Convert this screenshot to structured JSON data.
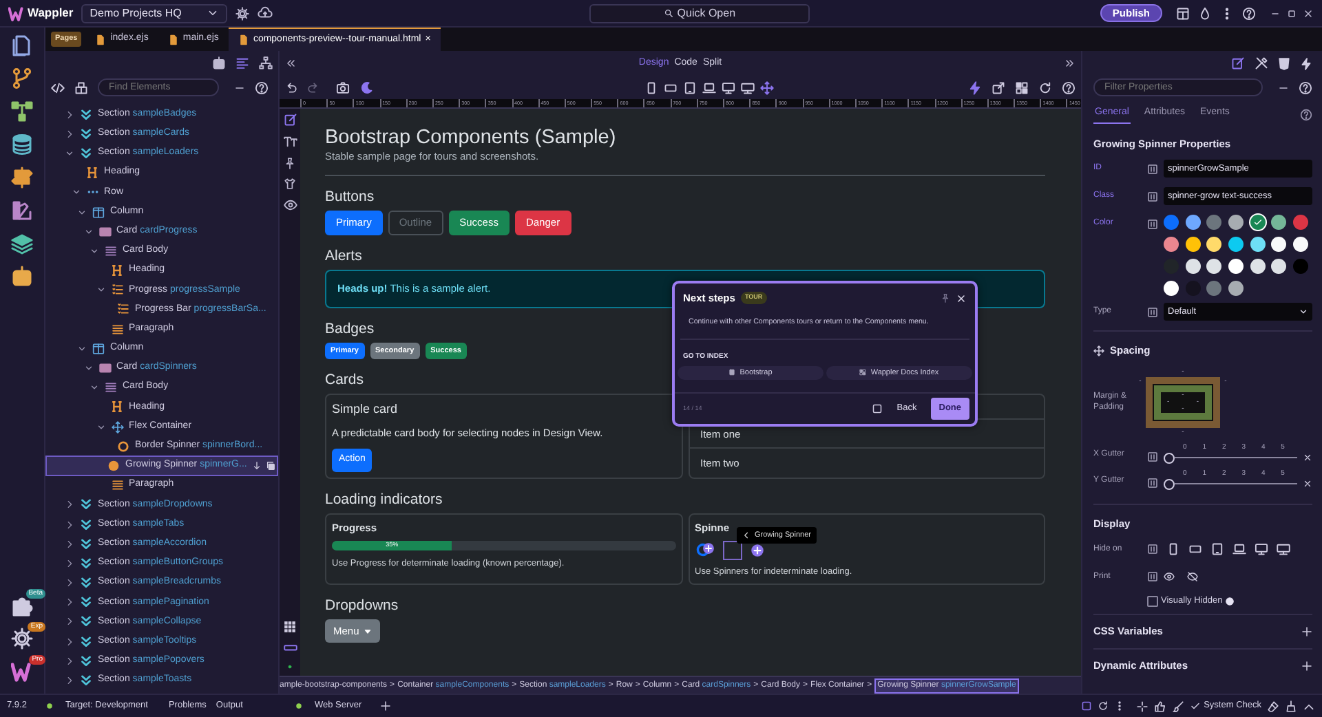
{
  "app": {
    "name": "Wappler",
    "project": "Demo Projects HQ",
    "quick_open": "Quick Open",
    "publish": "Publish"
  },
  "rail": {
    "badges": [
      "Beta",
      "Exp",
      "Pro"
    ]
  },
  "tabs": {
    "group": "Pages",
    "items": [
      {
        "label": "index.ejs",
        "selected": false
      },
      {
        "label": "main.ejs",
        "selected": false
      },
      {
        "label": "components-preview--tour-manual.html",
        "selected": true,
        "close": "×"
      }
    ]
  },
  "structure": {
    "search": {
      "placeholder": "Find Elements"
    },
    "tree": [
      {
        "label": "Section",
        "id": "sampleBadges",
        "kind": "section",
        "expanded": false,
        "selected": false
      },
      {
        "label": "Section",
        "id": "sampleCards",
        "kind": "section",
        "expanded": false,
        "selected": false
      },
      {
        "label": "Section",
        "id": "sampleLoaders",
        "kind": "section",
        "expanded": true,
        "selected": false,
        "children": [
          {
            "label": "Heading",
            "kind": "heading",
            "selected": false
          },
          {
            "label": "Row",
            "kind": "row",
            "expanded": true,
            "selected": false,
            "children": [
              {
                "label": "Column",
                "kind": "column",
                "expanded": true,
                "selected": false,
                "children": [
                  {
                    "label": "Card",
                    "id": "cardProgress",
                    "kind": "card",
                    "expanded": true,
                    "selected": false,
                    "children": [
                      {
                        "label": "Card Body",
                        "kind": "card-body",
                        "expanded": true,
                        "selected": false,
                        "children": [
                          {
                            "label": "Heading",
                            "kind": "heading",
                            "selected": false
                          },
                          {
                            "label": "Progress",
                            "id": "progressSample",
                            "kind": "progress",
                            "expanded": true,
                            "selected": false,
                            "children": [
                              {
                                "label": "Progress Bar",
                                "id": "progressBarSa...",
                                "kind": "progress",
                                "selected": false
                              }
                            ]
                          },
                          {
                            "label": "Paragraph",
                            "kind": "paragraph",
                            "selected": false
                          }
                        ]
                      }
                    ]
                  }
                ]
              },
              {
                "label": "Column",
                "kind": "column",
                "expanded": true,
                "selected": false,
                "children": [
                  {
                    "label": "Card",
                    "id": "cardSpinners",
                    "kind": "card",
                    "expanded": true,
                    "selected": false,
                    "children": [
                      {
                        "label": "Card Body",
                        "kind": "card-body",
                        "expanded": true,
                        "selected": false,
                        "children": [
                          {
                            "label": "Heading",
                            "kind": "heading",
                            "selected": false
                          },
                          {
                            "label": "Flex Container",
                            "kind": "flex",
                            "expanded": true,
                            "selected": false,
                            "children": [
                              {
                                "label": "Border Spinner",
                                "id": "spinnerBord...",
                                "kind": "border-spinner",
                                "selected": false
                              },
                              {
                                "label": "Growing Spinner",
                                "id": "spinnerG...",
                                "kind": "grow-spinner",
                                "selected": true
                              }
                            ]
                          },
                          {
                            "label": "Paragraph",
                            "kind": "paragraph",
                            "selected": false
                          }
                        ]
                      }
                    ]
                  }
                ]
              }
            ]
          }
        ]
      },
      {
        "label": "Section",
        "id": "sampleDropdowns",
        "kind": "section",
        "expanded": false,
        "selected": false
      },
      {
        "label": "Section",
        "id": "sampleTabs",
        "kind": "section",
        "expanded": false,
        "selected": false
      },
      {
        "label": "Section",
        "id": "sampleAccordion",
        "kind": "section",
        "expanded": false,
        "selected": false
      },
      {
        "label": "Section",
        "id": "sampleButtonGroups",
        "kind": "section",
        "expanded": false,
        "selected": false
      },
      {
        "label": "Section",
        "id": "sampleBreadcrumbs",
        "kind": "section",
        "expanded": false,
        "selected": false
      },
      {
        "label": "Section",
        "id": "samplePagination",
        "kind": "section",
        "expanded": false,
        "selected": false
      },
      {
        "label": "Section",
        "id": "sampleCollapse",
        "kind": "section",
        "expanded": false,
        "selected": false
      },
      {
        "label": "Section",
        "id": "sampleTooltips",
        "kind": "section",
        "expanded": false,
        "selected": false
      },
      {
        "label": "Section",
        "id": "samplePopovers",
        "kind": "section",
        "expanded": false,
        "selected": false
      },
      {
        "label": "Section",
        "id": "sampleToasts",
        "kind": "section",
        "expanded": false,
        "selected": false
      }
    ]
  },
  "view_modes": [
    {
      "label": "Design",
      "selected": true
    },
    {
      "label": "Code",
      "selected": false
    },
    {
      "label": "Split",
      "selected": false
    }
  ],
  "ruler": {
    "labels": [
      "0",
      "50",
      "100",
      "150",
      "200",
      "250",
      "300",
      "350",
      "400",
      "450",
      "500",
      "550",
      "600",
      "650",
      "700",
      "750",
      "800",
      "850",
      "900",
      "950",
      "1000",
      "1050",
      "1100",
      "1150",
      "1200",
      "1250",
      "1300",
      "1350",
      "1400",
      "1450"
    ]
  },
  "canvas": {
    "title": "Bootstrap Components (Sample)",
    "subtitle": "Stable sample page for tours and screenshots.",
    "buttons_heading": "Buttons",
    "buttons": [
      {
        "label": "Primary"
      },
      {
        "label": "Outline"
      },
      {
        "label": "Success"
      },
      {
        "label": "Danger"
      }
    ],
    "alerts_heading": "Alerts",
    "alert": "**Heads up!** This is a sample alert.",
    "badges_heading": "Badges",
    "badges": [
      {
        "label": "Primary"
      },
      {
        "label": "Secondary"
      },
      {
        "label": "Success"
      }
    ],
    "cards_heading": "Cards",
    "card": {
      "title": "Simple card",
      "text": "A predictable card body for selecting nodes in Design View.",
      "button": "Action"
    },
    "list_items": [
      "Item one",
      "Item two"
    ],
    "loading_heading": "Loading indicators",
    "progress_card": {
      "title": "Progress",
      "level": 0.35,
      "reading": "35%",
      "text": "Use Progress for determinate loading (known percentage)."
    },
    "spinner_card": {
      "title": "Spinne",
      "text": "Use Spinners for indeterminate loading."
    },
    "dropdowns_heading": "Dropdowns",
    "dropdown": "Menu"
  },
  "tour": {
    "title": "Next steps",
    "badge": "TOUR",
    "text": "Continue with other Components tours or return to the Components menu.",
    "index_heading": "GO TO INDEX",
    "links": [
      "Bootstrap",
      "Wappler Docs Index"
    ],
    "step": "14 / 14",
    "back": "Back",
    "done": "Done"
  },
  "tooltip": {
    "label": "Growing Spinner"
  },
  "breadcrumb": [
    {
      "type": "ample-bootstrap-components",
      "selected": false
    },
    {
      "sep": ">",
      "type": "Container",
      "id": "sampleComponents",
      "selected": false
    },
    {
      "sep": ">",
      "type": "Section",
      "id": "sampleLoaders",
      "selected": false
    },
    {
      "sep": ">",
      "type": "Row",
      "selected": false
    },
    {
      "sep": ">",
      "type": "Column",
      "selected": false
    },
    {
      "sep": ">",
      "type": "Card",
      "id": "cardSpinners",
      "selected": false
    },
    {
      "sep": ">",
      "type": "Card Body",
      "selected": false
    },
    {
      "sep": ">",
      "type": "Flex Container",
      "selected": false
    },
    {
      "sep": ">",
      "type": "Growing Spinner",
      "id": "spinnerGrowSample",
      "selected": true
    }
  ],
  "properties": {
    "search": {
      "placeholder": "Filter Properties"
    },
    "tabs": [
      {
        "label": "General",
        "selected": true
      },
      {
        "label": "Attributes",
        "selected": false
      },
      {
        "label": "Events",
        "selected": false
      }
    ],
    "title": "Growing Spinner Properties",
    "fields": [
      {
        "label": "ID",
        "set": true,
        "kind": "text",
        "value": "spinnerGrowSample"
      },
      {
        "label": "Class",
        "set": true,
        "kind": "text",
        "value": "spinner-grow text-success"
      },
      {
        "label": "Color",
        "set": true,
        "kind": "colors",
        "swatches": [
          {
            "color": "#0d6efd",
            "selected": false
          },
          {
            "color": "#6ea8fe",
            "selected": false
          },
          {
            "color": "#6c757d",
            "selected": false
          },
          {
            "color": "#a7acb1",
            "selected": false
          },
          {
            "color": "#198754",
            "selected": true
          },
          {
            "color": "#75b798",
            "selected": false
          },
          {
            "color": "#dc3545",
            "selected": false
          },
          {
            "color": "#ea868f",
            "selected": false
          },
          {
            "color": "#ffc107",
            "selected": false
          },
          {
            "color": "#ffda6a",
            "selected": false
          },
          {
            "color": "#0dcaf0",
            "selected": false
          },
          {
            "color": "#6edff6",
            "selected": false
          },
          {
            "color": "#f8f9fa",
            "selected": false
          },
          {
            "color": "#f8f9fa",
            "selected": false
          },
          {
            "color": "#212529",
            "selected": false
          },
          {
            "color": "#dee2e6",
            "selected": false
          },
          {
            "color": "#dee2e6",
            "selected": false
          },
          {
            "color": "#ffffff",
            "selected": false
          },
          {
            "color": "#dee2e6",
            "selected": false
          },
          {
            "color": "#dee2e6",
            "selected": false
          },
          {
            "color": "#000000",
            "selected": false
          },
          {
            "color": "#ffffff",
            "selected": false
          },
          {
            "color": "#15121f",
            "selected": false
          },
          {
            "color": "#6c757d",
            "selected": false
          },
          {
            "color": "#a7acb1",
            "selected": false
          }
        ]
      },
      {
        "label": "Type",
        "set": false,
        "kind": "select",
        "value": "Default"
      }
    ],
    "spacing": {
      "title": "Spacing",
      "box_label": "Margin & Padding",
      "margin": [
        "-",
        "-",
        "-",
        "-"
      ],
      "padding": [
        "-",
        "-",
        "-",
        "-"
      ],
      "gutters": [
        {
          "label": "X Gutter",
          "ticks": [
            "0",
            "1",
            "2",
            "3",
            "4",
            "5"
          ],
          "level": 0
        },
        {
          "label": "Y Gutter",
          "ticks": [
            "0",
            "1",
            "2",
            "3",
            "4",
            "5"
          ],
          "level": 0
        }
      ]
    },
    "display": {
      "title": "Display",
      "hide_on": "Hide on",
      "print": "Print",
      "visually_hidden": {
        "label": "Visually Hidden",
        "checked": false
      }
    },
    "sections": [
      "CSS Variables",
      "Dynamic Attributes"
    ]
  },
  "status_bar": {
    "version": "7.9.2",
    "target": "Target: Development",
    "tabs": [
      "Problems",
      "Output"
    ],
    "server": "Web Server",
    "system_check": "System Check"
  }
}
